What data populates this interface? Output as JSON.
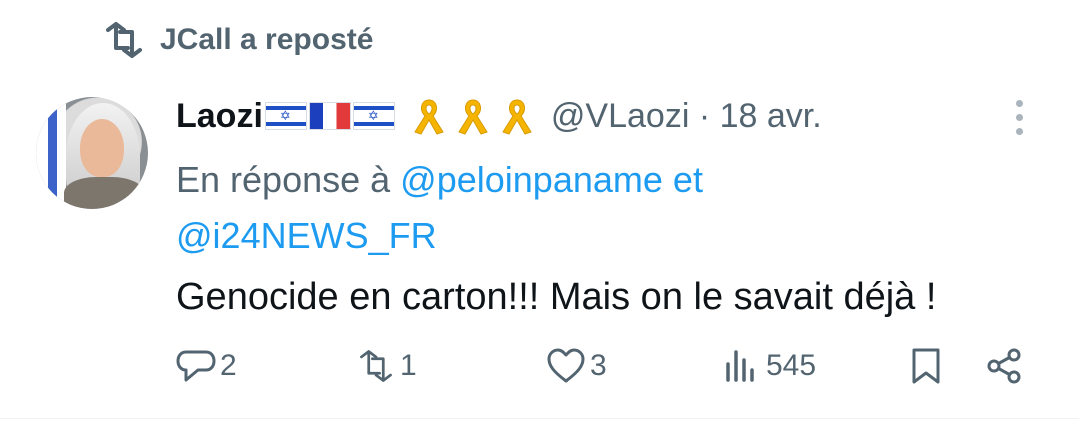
{
  "repost": {
    "text": "JCall a reposté",
    "icon": "repost-icon"
  },
  "author": {
    "name": "Laozi",
    "flags": [
      "israel-flag",
      "france-flag",
      "israel-flag"
    ],
    "ribbons": [
      "yellow-ribbon",
      "yellow-ribbon",
      "yellow-ribbon"
    ],
    "handle": "@VLaozi",
    "separator": "·",
    "date": "18 avr."
  },
  "reply_to": {
    "prefix": "En réponse à",
    "mention1": "@peloinpaname",
    "joiner": "et",
    "mention2": "@i24NEWS_FR"
  },
  "tweet": {
    "text": "Genocide en carton!!! Mais on le savait déjà !"
  },
  "actions": {
    "replies": "2",
    "reposts": "1",
    "likes": "3",
    "views": "545"
  },
  "colors": {
    "accent": "#1d9bf0",
    "muted": "#536471",
    "text": "#0f1419"
  }
}
